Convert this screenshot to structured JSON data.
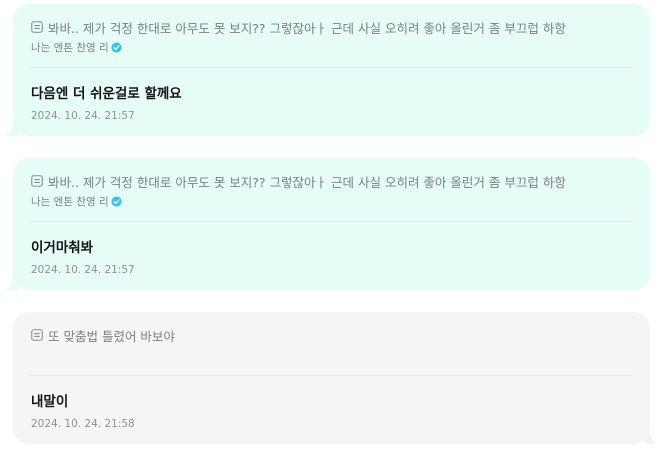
{
  "messages": [
    {
      "quote_icon": "document-icon",
      "quote": "봐바.. 제가 걱정 한대로 아무도 못 보지?? 그렇잖아ㅏ 근데 사실 오히려 좋아 올린거 좀 부끄럽 하항",
      "author": "나는 엔톤 찬영 리",
      "author_badge": "verified-icon",
      "text": "다음엔 더 쉬운걸로 할께요",
      "timestamp": "2024. 10. 24. 21:57"
    },
    {
      "quote_icon": "document-icon",
      "quote": "봐바.. 제가 걱정 한대로 아무도 못 보지?? 그렇잖아ㅏ 근데 사실 오히려 좋아 올린거 좀 부끄럽 하항",
      "author": "나는 엔톤 찬영 리",
      "author_badge": "verified-icon",
      "text": "이거마춰봐",
      "timestamp": "2024. 10. 24. 21:57"
    },
    {
      "quote_icon": "document-icon",
      "quote": "또 맞춤법 틀렸어 바보야",
      "text": "내말이",
      "timestamp": "2024. 10. 24. 21:58"
    }
  ],
  "colors": {
    "mint_bubble": "#e6fcf6",
    "gray_bubble": "#f5f5f7",
    "verified_badge": "#36c4e6"
  }
}
